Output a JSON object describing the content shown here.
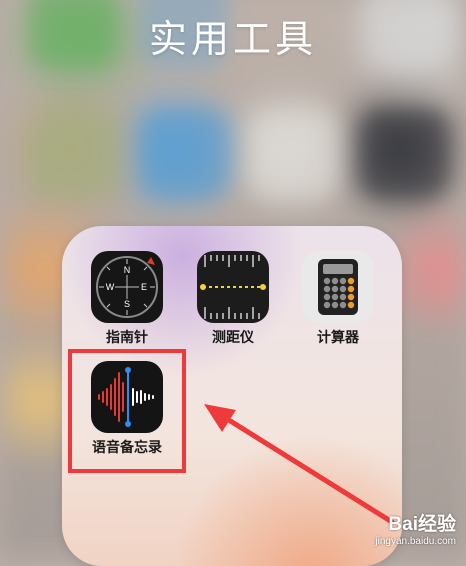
{
  "folder": {
    "title": "实用工具",
    "apps": [
      {
        "label": "指南针",
        "icon": "compass-icon"
      },
      {
        "label": "测距仪",
        "icon": "measure-icon"
      },
      {
        "label": "计算器",
        "icon": "calculator-icon"
      },
      {
        "label": "语音备忘录",
        "icon": "voice-memos-icon"
      }
    ]
  },
  "annotation": {
    "highlight_color": "#ee3a3a",
    "arrow_color": "#ee3a3a"
  },
  "watermark": {
    "brand": "Bai经验",
    "url": "jingyan.baidu.com"
  }
}
